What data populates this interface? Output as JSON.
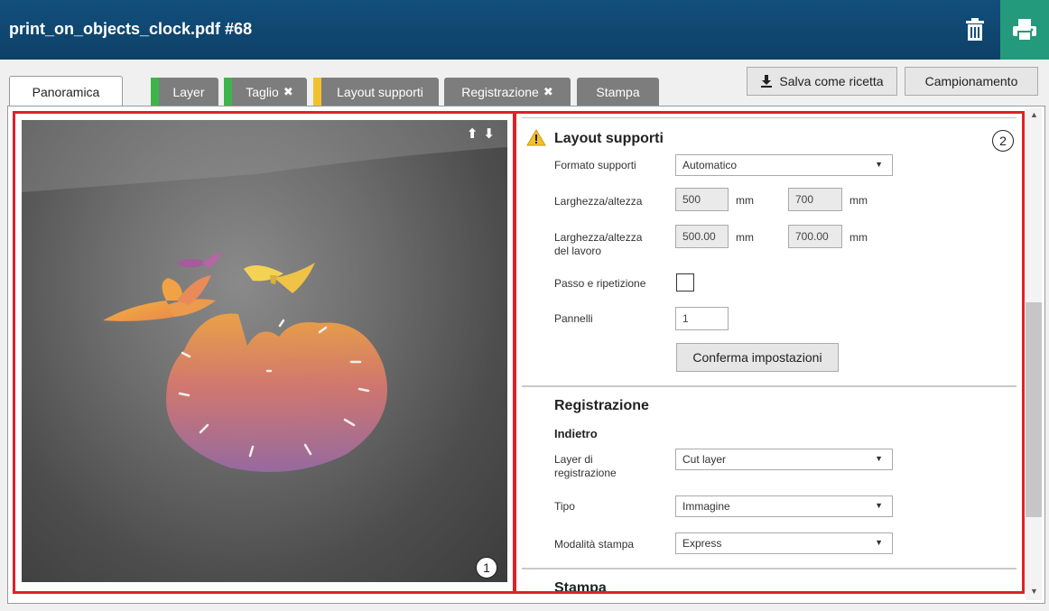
{
  "window": {
    "title": "print_on_objects_clock.pdf #68"
  },
  "colors": {
    "header": "#124f7c",
    "print_button": "#239a7c",
    "active_stripe": "#3db54a",
    "warning_stripe": "#f2c12e",
    "highlight_box": "#e0202a"
  },
  "tabs": [
    {
      "label": "Panoramica",
      "active": true
    },
    {
      "label": "Layer",
      "status": "green"
    },
    {
      "label": "Taglio",
      "status": "green",
      "error": "✖"
    },
    {
      "label": "Layout supporti",
      "status": "yellow"
    },
    {
      "label": "Registrazione",
      "error": "✖"
    },
    {
      "label": "Stampa"
    }
  ],
  "toolbar": {
    "save_recipe": "Salva come ricetta",
    "sampling": "Campionamento"
  },
  "viewer": {
    "arrows": "⬆⬇",
    "marker": "1"
  },
  "panel": {
    "marker": "2",
    "layout": {
      "title": "Layout supporti",
      "media_format_label": "Formato supporti",
      "media_format_value": "Automatico",
      "size_label": "Larghezza/altezza",
      "width": "500",
      "height": "700",
      "unit": "mm",
      "job_size_label_1": "Larghezza/altezza",
      "job_size_label_2": "del lavoro",
      "job_width": "500.00",
      "job_height": "700.00",
      "step_repeat_label": "Passo e ripetizione",
      "panels_label": "Pannelli",
      "panels_value": "1",
      "confirm_button": "Conferma impostazioni"
    },
    "registration": {
      "title": "Registrazione",
      "subtitle": "Indietro",
      "layer_label_1": "Layer di",
      "layer_label_2": "registrazione",
      "layer_value": "Cut layer",
      "type_label": "Tipo",
      "type_value": "Immagine",
      "mode_label": "Modalità stampa",
      "mode_value": "Express"
    },
    "print": {
      "title": "Stampa"
    }
  }
}
